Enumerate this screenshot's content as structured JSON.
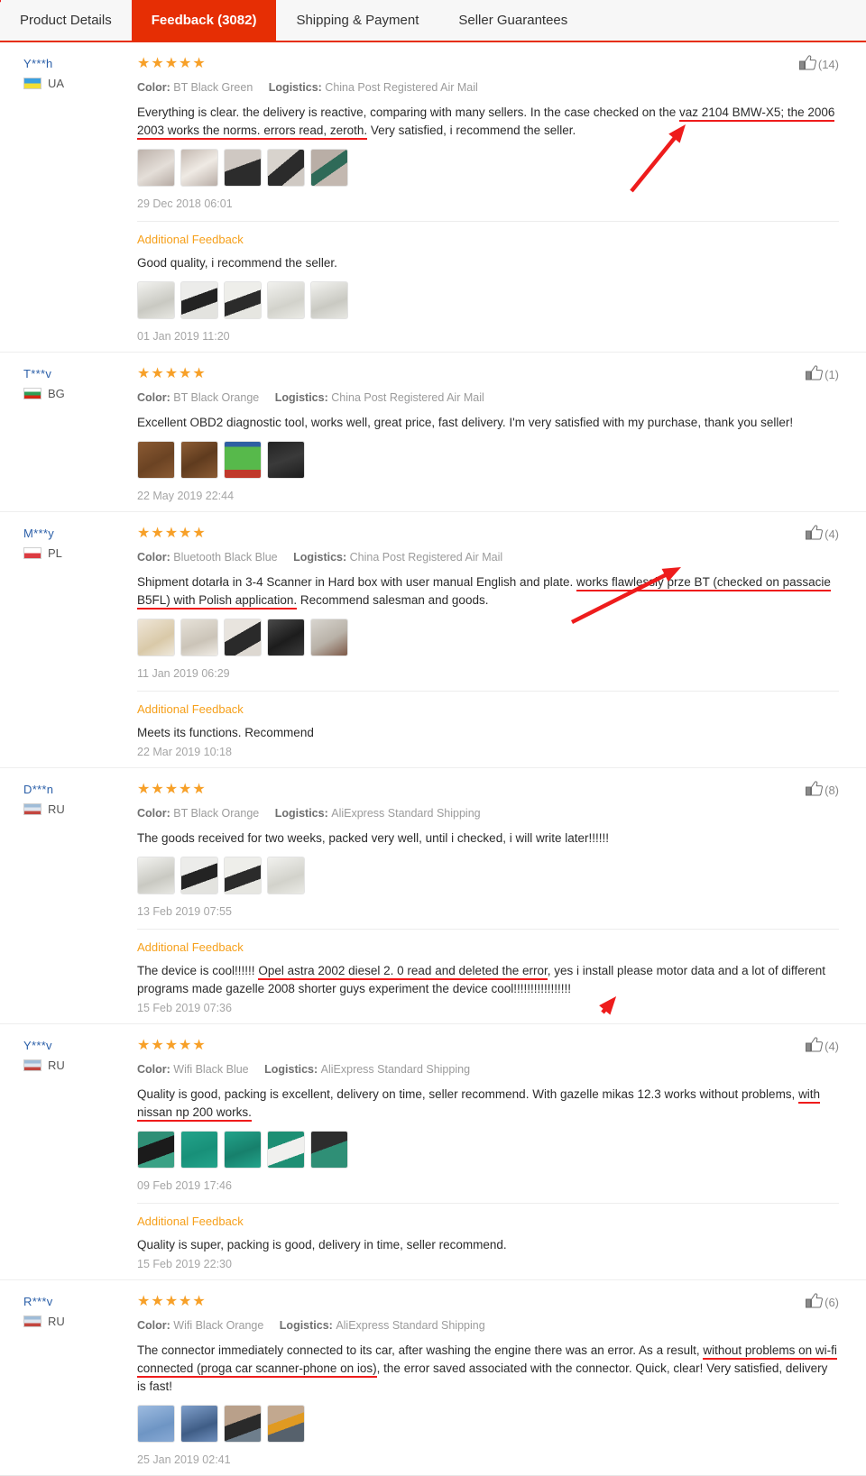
{
  "tabs": [
    {
      "label": "Product Details",
      "active": false
    },
    {
      "label": "Feedback (3082)",
      "active": true
    },
    {
      "label": "Shipping & Payment",
      "active": false
    },
    {
      "label": "Seller Guarantees",
      "active": false
    }
  ],
  "labels": {
    "color": "Color:",
    "logistics": "Logistics:",
    "additional_feedback": "Additional Feedback",
    "stars": "★★★★★"
  },
  "colors": {
    "accent": "#e62e04",
    "star": "#f7a028",
    "link": "#2b5fa8",
    "additional": "#f6a01b",
    "underline": "#ef1b1b"
  },
  "reviews": [
    {
      "buyer": "Y***h",
      "country": "UA",
      "flag": "flag-ua",
      "stars": "★★★★★",
      "helpful_count": "(14)",
      "color_value": "BT Black Green",
      "logistics_value": "China Post Registered Air Mail",
      "text_pre": "Everything is clear. the delivery is reactive, comparing with many sellers. In the case checked on the ",
      "text_underline": "vaz 2104 BMW-X5; the 2006 2003 works the norms. errors read, zeroth.",
      "text_post": " Very satisfied, i recommend the seller.",
      "photo_count": 5,
      "date": "29 Dec 2018 06:01",
      "additional": {
        "text": "Good quality, i recommend the seller.",
        "photo_count": 5,
        "date": "01 Jan 2019 11:20"
      }
    },
    {
      "buyer": "T***v",
      "country": "BG",
      "flag": "flag-bg",
      "stars": "★★★★★",
      "helpful_count": "(1)",
      "color_value": "BT Black Orange",
      "logistics_value": "China Post Registered Air Mail",
      "text_pre": "Excellent OBD2 diagnostic tool, works well, great price, fast delivery. I'm very satisfied with my purchase, thank you seller!",
      "text_underline": "",
      "text_post": "",
      "photo_count": 4,
      "date": "22 May 2019 22:44",
      "additional": null
    },
    {
      "buyer": "M***y",
      "country": "PL",
      "flag": "flag-pl",
      "stars": "★★★★★",
      "helpful_count": "(4)",
      "color_value": "Bluetooth Black Blue",
      "logistics_value": "China Post Registered Air Mail",
      "text_pre": "Shipment dotarła in 3-4 Scanner in Hard box with user manual English and plate. ",
      "text_underline": "works flawlessly prze BT (checked on passacie B5FL) with Polish application.",
      "text_post": " Recommend salesman and goods.",
      "photo_count": 5,
      "date": "11 Jan 2019 06:29",
      "additional": {
        "text": "Meets its functions. Recommend",
        "photo_count": 0,
        "date": "22 Mar 2019 10:18"
      }
    },
    {
      "buyer": "D***n",
      "country": "RU",
      "flag": "flag-ru",
      "stars": "★★★★★",
      "helpful_count": "(8)",
      "color_value": "BT Black Orange",
      "logistics_value": "AliExpress Standard Shipping",
      "text_pre": "The goods received for two weeks, packed very well, until i checked, i will write later!!!!!!",
      "text_underline": "",
      "text_post": "",
      "photo_count": 4,
      "date": "13 Feb 2019 07:55",
      "additional": {
        "text_pre": "The device is cool!!!!!! ",
        "text_underline": "Opel astra 2002 diesel 2. 0 read and deleted the error",
        "text_post": ", yes i install please motor data and a lot of different programs made gazelle 2008 shorter guys experiment the device cool!!!!!!!!!!!!!!!!!",
        "photo_count": 0,
        "date": "15 Feb 2019 07:36"
      }
    },
    {
      "buyer": "Y***v",
      "country": "RU",
      "flag": "flag-ru",
      "stars": "★★★★★",
      "helpful_count": "(4)",
      "color_value": "Wifi Black Blue",
      "logistics_value": "AliExpress Standard Shipping",
      "text_pre": "Quality is good, packing is excellent, delivery on time, seller recommend. With gazelle mikas 12.3 works without problems, ",
      "text_underline": "with nissan np 200 works.",
      "text_post": "",
      "photo_count": 5,
      "date": "09 Feb 2019 17:46",
      "additional": {
        "text": "Quality is super, packing is good, delivery in time, seller recommend.",
        "photo_count": 0,
        "date": "15 Feb 2019 22:30"
      }
    },
    {
      "buyer": "R***v",
      "country": "RU",
      "flag": "flag-ru",
      "stars": "★★★★★",
      "helpful_count": "(6)",
      "color_value": "Wifi Black Orange",
      "logistics_value": "AliExpress Standard Shipping",
      "text_pre": "The connector immediately connected to its car, after washing the engine there was an error. As a result, ",
      "text_underline": "without problems on wi-fi connected (proga car scanner-phone on ios)",
      "text_post": ", the error saved associated with the connector. Quick, clear! Very satisfied, delivery is fast!",
      "photo_count": 4,
      "date": "25 Jan 2019 02:41",
      "additional": null
    }
  ],
  "annotations": [
    {
      "name": "arrow-1",
      "points_to": "vaz 2104 BMW-X5; the 2006"
    },
    {
      "name": "arrow-2",
      "points_to": "works flawlessly prze BT (checked on passacie"
    },
    {
      "name": "arrow-3",
      "points_to": "Opel astra 2002 diesel 2. 0 read and deleted the error"
    },
    {
      "name": "arrow-4",
      "points_to": "with nissan np 200 works."
    }
  ]
}
